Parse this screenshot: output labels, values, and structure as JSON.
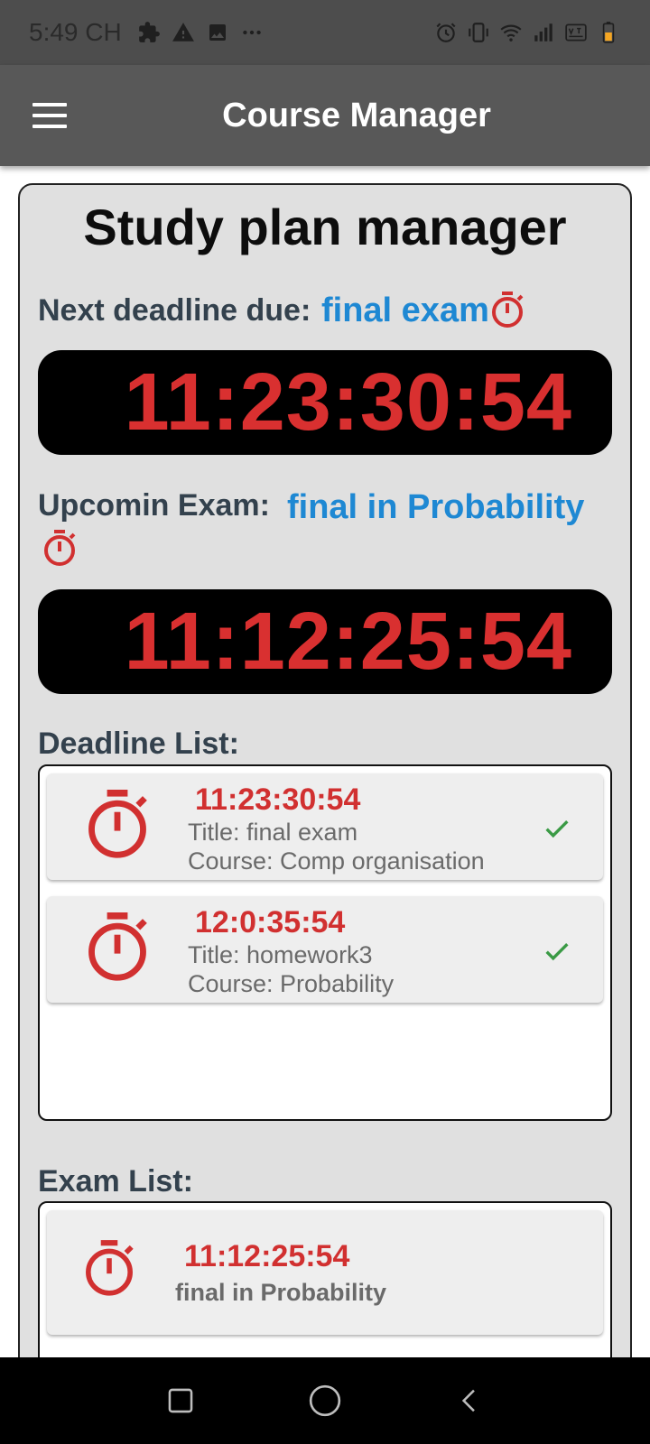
{
  "status_bar": {
    "time": "5:49 CH"
  },
  "app_bar": {
    "title": "Course Manager"
  },
  "main": {
    "title": "Study plan manager",
    "next_deadline_label": "Next deadline due:",
    "next_deadline_name": "final exam",
    "next_deadline_countdown": "11:23:30:54",
    "upcoming_exam_label": "Upcomin Exam:",
    "upcoming_exam_name": "final in Probability",
    "upcoming_exam_countdown": "11:12:25:54",
    "deadline_list_label": "Deadline List:",
    "deadlines": [
      {
        "countdown": "11:23:30:54",
        "title": "Title: final exam",
        "course": "Course: Comp organisation"
      },
      {
        "countdown": "12:0:35:54",
        "title": "Title: homework3",
        "course": "Course: Probability"
      }
    ],
    "exam_list_label": "Exam List:",
    "exams": [
      {
        "countdown": "11:12:25:54",
        "name": "final in Probability"
      }
    ]
  },
  "colors": {
    "accent_red": "#d93030",
    "link_blue": "#1e88d3",
    "check_green": "#3a9a45",
    "app_bar": "#585858"
  }
}
